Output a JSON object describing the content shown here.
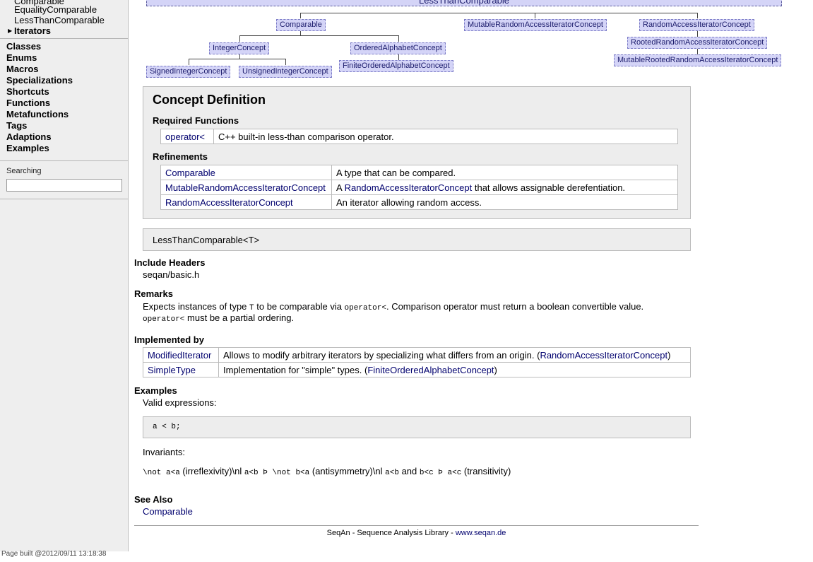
{
  "sidebar": {
    "sub_items": [
      "Comparable",
      "EqualityComparable",
      "LessThanComparable"
    ],
    "current": "Iterators",
    "items": [
      "Classes",
      "Enums",
      "Macros",
      "Specializations",
      "Shortcuts",
      "Functions",
      "Metafunctions",
      "Tags",
      "Adaptions",
      "Examples"
    ],
    "search_label": "Searching",
    "search_value": "",
    "page_built": "Page built @2012/09/11 13:18:38"
  },
  "graph": {
    "root": "LessThanComparable",
    "nodes": [
      "Comparable",
      "MutableRandomAccessIteratorConcept",
      "RandomAccessIteratorConcept",
      "IntegerConcept",
      "OrderedAlphabetConcept",
      "RootedRandomAccessIteratorConcept",
      "SignedIntegerConcept",
      "UnsignedIntegerConcept",
      "FiniteOrderedAlphabetConcept",
      "MutableRootedRandomAccessIteratorConcept"
    ]
  },
  "concept": {
    "title": "Concept Definition",
    "required_label": "Required Functions",
    "required": [
      {
        "name": "operator<",
        "desc": "C++ built-in less-than comparison operator."
      }
    ],
    "refinements_label": "Refinements",
    "refinements": [
      {
        "name": "Comparable",
        "desc": "A type that can be compared."
      },
      {
        "name": "MutableRandomAccessIteratorConcept",
        "desc_pre": "A ",
        "desc_link": "RandomAccessIteratorConcept",
        "desc_post": " that allows assignable derefentiation."
      },
      {
        "name": "RandomAccessIteratorConcept",
        "desc": "An iterator allowing random access."
      }
    ]
  },
  "signature": "LessThanComparable<T>",
  "include": {
    "label": "Include Headers",
    "value": "seqan/basic.h"
  },
  "remarks": {
    "label": "Remarks",
    "l1_a": "Expects instances of type ",
    "l1_code1": "T",
    "l1_b": " to be comparable via ",
    "l1_code2": "operator<",
    "l1_c": ". Comparison operator must return a boolean convertible value.",
    "l2_code": "operator<",
    "l2_text": " must be a partial ordering."
  },
  "implemented": {
    "label": "Implemented by",
    "rows": [
      {
        "name": "ModifiedIterator",
        "desc": "Allows to modify arbitrary iterators by specializing what differs from an origin. (",
        "link": "RandomAccessIteratorConcept",
        "post": ")"
      },
      {
        "name": "SimpleType",
        "desc": "Implementation for \"simple\" types. (",
        "link": "FiniteOrderedAlphabetConcept",
        "post": ")"
      }
    ]
  },
  "examples": {
    "label": "Examples",
    "valid": "Valid expressions:",
    "code": "a < b;",
    "invariants": "Invariants:",
    "inv": {
      "c1": "\\not a<a",
      "t1": " (irreflexivity)\\nl ",
      "c2": "a<b Þ \\not b<a",
      "t2": " (antisymmetry)\\nl ",
      "c3": "a<b",
      "t3": " and ",
      "c4": "b<c Þ a<c",
      "t4": " (transitivity)"
    }
  },
  "see_also": {
    "label": "See Also",
    "link": "Comparable"
  },
  "footer": {
    "text": "SeqAn - Sequence Analysis Library - ",
    "link": "www.seqan.de"
  }
}
